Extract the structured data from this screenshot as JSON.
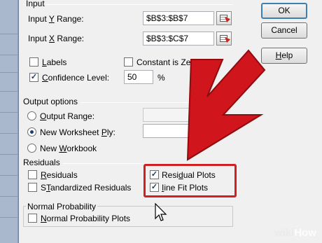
{
  "input_group": {
    "title": "Input"
  },
  "input_y": {
    "label_prefix": "Input ",
    "label_key": "Y",
    "label_suffix": " Range:",
    "value": "$B$3:$B$7"
  },
  "input_x": {
    "label_prefix": "Input ",
    "label_key": "X",
    "label_suffix": " Range:",
    "value": "$B$3:$C$7"
  },
  "labels_option": {
    "key": "L",
    "rest": "abels",
    "checked": false
  },
  "constant_option": {
    "text": "Constant is Ze",
    "checked": false
  },
  "confidence_option": {
    "key": "C",
    "rest": "onfidence Level:",
    "checked": true,
    "value": "50",
    "unit": "%"
  },
  "output_group": {
    "title": "Output options",
    "output_range": {
      "key": "O",
      "rest": "utput Range:",
      "selected": false
    },
    "new_worksheet": {
      "prefix": "New Worksheet ",
      "key": "P",
      "rest": "ly:",
      "selected": true
    },
    "new_workbook": {
      "prefix": "New ",
      "key": "W",
      "rest": "orkbook",
      "selected": false
    }
  },
  "residuals_group": {
    "title": "Residuals",
    "residuals": {
      "key": "R",
      "rest": "esiduals",
      "checked": false
    },
    "standardized": {
      "key": "T",
      "prefix": "S",
      "rest": "andardized Residuals",
      "checked": false
    },
    "residual_plots": {
      "prefix": "Resi",
      "key": "d",
      "rest": "ual Plots",
      "checked": true
    },
    "line_fit_plots": {
      "key": "I",
      "rest": "ine Fit Plots",
      "checked": true
    }
  },
  "normal_group": {
    "title": "Normal Probability",
    "normal_plots": {
      "key": "N",
      "rest": "ormal Probability Plots",
      "checked": false
    }
  },
  "buttons": {
    "ok": "OK",
    "cancel": "Cancel",
    "help_key": "H",
    "help_rest": "elp"
  },
  "annotation": {
    "arrow_color": "#d0151c",
    "box_color": "#d21f1f"
  },
  "watermark": {
    "wiki": "wiki",
    "how": "How"
  },
  "icons": {
    "check": "✓"
  }
}
